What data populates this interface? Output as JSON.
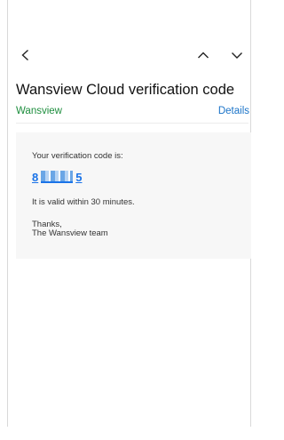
{
  "toolbar": {
    "back_icon": "chevron-left-icon",
    "prev_icon": "chevron-up-icon",
    "next_icon": "chevron-down-icon"
  },
  "email": {
    "subject": "Wansview Cloud verification code",
    "sender": "Wansview",
    "details_label": "Details",
    "body": {
      "intro": "Your verification code is:",
      "code_first": "8",
      "code_last": "5",
      "validity": "It is valid within 30 minutes.",
      "signoff": "Thanks,",
      "signature": "The Wansview team"
    }
  },
  "colors": {
    "sender": "#1e8e3e",
    "details": "#1a73c8",
    "code": "#1a73e8",
    "card_bg": "#f7f7f7"
  }
}
